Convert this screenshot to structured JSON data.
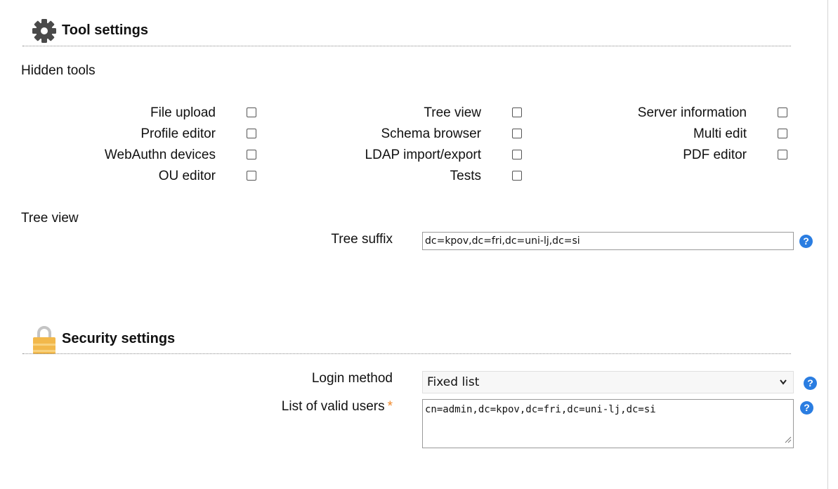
{
  "tool_settings": {
    "title": "Tool settings",
    "icon": "gear-icon",
    "hidden_tools": {
      "label": "Hidden tools",
      "col1": [
        "File upload",
        "Profile editor",
        "WebAuthn devices",
        "OU editor"
      ],
      "col2": [
        "Tree view",
        "Schema browser",
        "LDAP import/export",
        "Tests"
      ],
      "col3": [
        "Server information",
        "Multi edit",
        "PDF editor"
      ]
    },
    "tree_view": {
      "label": "Tree view",
      "suffix_label": "Tree suffix",
      "suffix_value": "dc=kpov,dc=fri,dc=uni-lj,dc=si"
    }
  },
  "security_settings": {
    "title": "Security settings",
    "icon": "lock-icon",
    "login_method": {
      "label": "Login method",
      "selected": "Fixed list"
    },
    "valid_users": {
      "label": "List of valid users",
      "required_mark": "*",
      "value": "cn=admin,dc=kpov,dc=fri,dc=uni-lj,dc=si"
    }
  },
  "help": {
    "glyph": "?"
  },
  "colors": {
    "help_blue": "#2a7de1",
    "required_orange": "#f0882a",
    "lock_gold": "#f2b84b"
  }
}
